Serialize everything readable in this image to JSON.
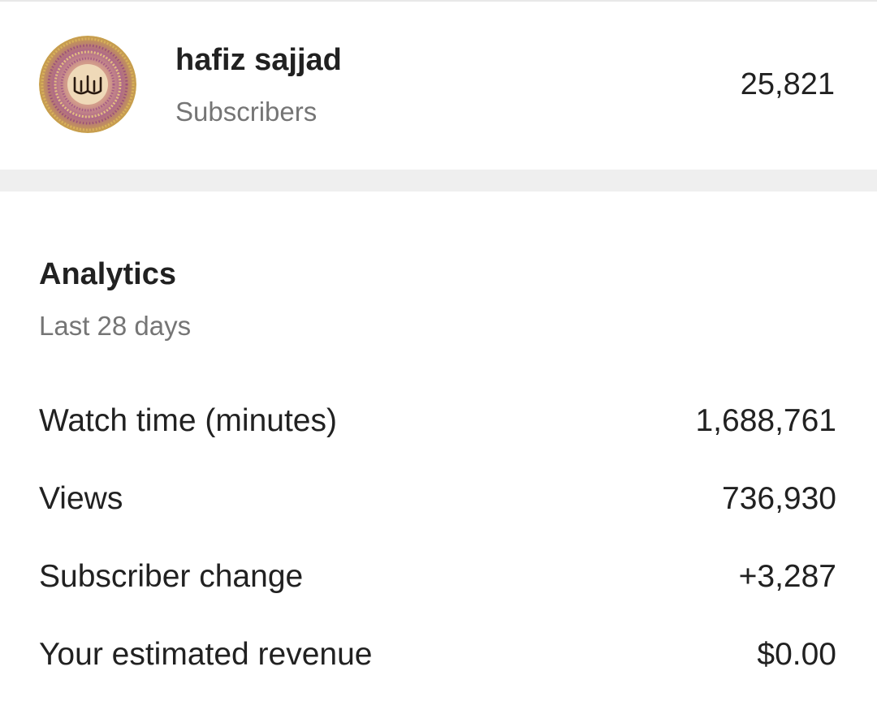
{
  "channel": {
    "name": "hafiz sajjad",
    "subscribers_label": "Subscribers",
    "subscribers_count": "25,821",
    "avatar_icon": "calligraphy-avatar-icon"
  },
  "analytics": {
    "title": "Analytics",
    "period": "Last 28 days",
    "metrics": [
      {
        "label": "Watch time (minutes)",
        "value": "1,688,761"
      },
      {
        "label": "Views",
        "value": "736,930"
      },
      {
        "label": "Subscriber change",
        "value": "+3,287"
      },
      {
        "label": "Your estimated revenue",
        "value": "$0.00"
      }
    ]
  },
  "colors": {
    "primary_text": "#212121",
    "secondary_text": "#757575",
    "separator": "#efefef",
    "avatar_outer": "#c9a24a",
    "avatar_inner": "#b0607c"
  }
}
